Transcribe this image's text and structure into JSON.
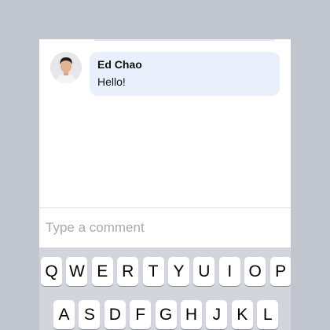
{
  "comments": [
    {
      "author": "Ed Chao",
      "text": "Hello!"
    }
  ],
  "comment_input": {
    "placeholder": "Type a comment",
    "value": ""
  },
  "keyboard": {
    "row1": [
      "Q",
      "W",
      "E",
      "R",
      "T",
      "Y",
      "U",
      "I",
      "O",
      "P"
    ],
    "row2": [
      "A",
      "S",
      "D",
      "F",
      "G",
      "H",
      "J",
      "K",
      "L"
    ]
  },
  "colors": {
    "page_background": "#c0c5ce",
    "bubble_background": "#eaf0fb",
    "keyboard_background": "#d2d5db"
  },
  "icons": {
    "avatar": "user-avatar-photo"
  }
}
